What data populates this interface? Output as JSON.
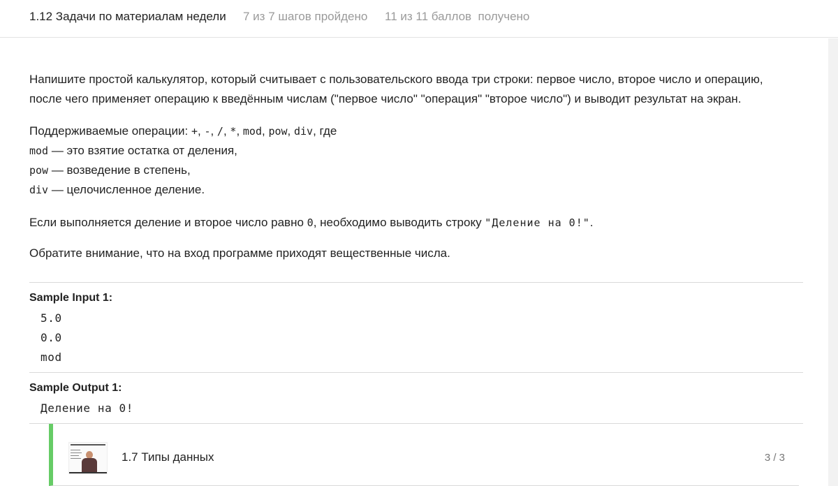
{
  "header": {
    "title": "1.12 Задачи по материалам недели",
    "steps": "7 из 7 шагов пройдено",
    "points": "11 из 11 баллов  получено"
  },
  "description": {
    "p1_line1": "Напишите простой калькулятор, который считывает с пользовательского ввода три строки: первое число, второе число и операцию,",
    "p1_line2": "после чего применяет операцию к введённым числам (\"первое число\" \"операция\" \"второе число\") и выводит результат на экран.",
    "ops_prefix": "Поддерживаемые операции: ",
    "op_plus": "+",
    "op_minus": "-",
    "op_div": "/",
    "op_mul": "*",
    "op_mod": "mod",
    "op_pow": "pow",
    "op_idiv": "div",
    "ops_suffix": ", где",
    "sep": ", ",
    "mod_code": "mod",
    "mod_text": " — это взятие остатка от деления,",
    "pow_code": "pow",
    "pow_text": " — возведение в степень,",
    "div_code": "div",
    "div_text": " — целочисленное деление.",
    "zero_prefix": "Если выполняется деление и второе число равно ",
    "zero_code": "0",
    "zero_mid": ", необходимо выводить строку ",
    "zero_msg": "\"Деление на 0!\"",
    "zero_end": ".",
    "note": "Обратите внимание, что на вход программе приходят вещественные числа."
  },
  "sample_input": {
    "label": "Sample Input 1:",
    "lines": [
      "5.0",
      "0.0",
      "mod"
    ]
  },
  "sample_output": {
    "label": "Sample Output 1:",
    "lines": [
      "Деление на 0!"
    ]
  },
  "lesson": {
    "title": "1.7 Типы данных",
    "progress": "3 / 3",
    "status_color": "#66cc66"
  }
}
